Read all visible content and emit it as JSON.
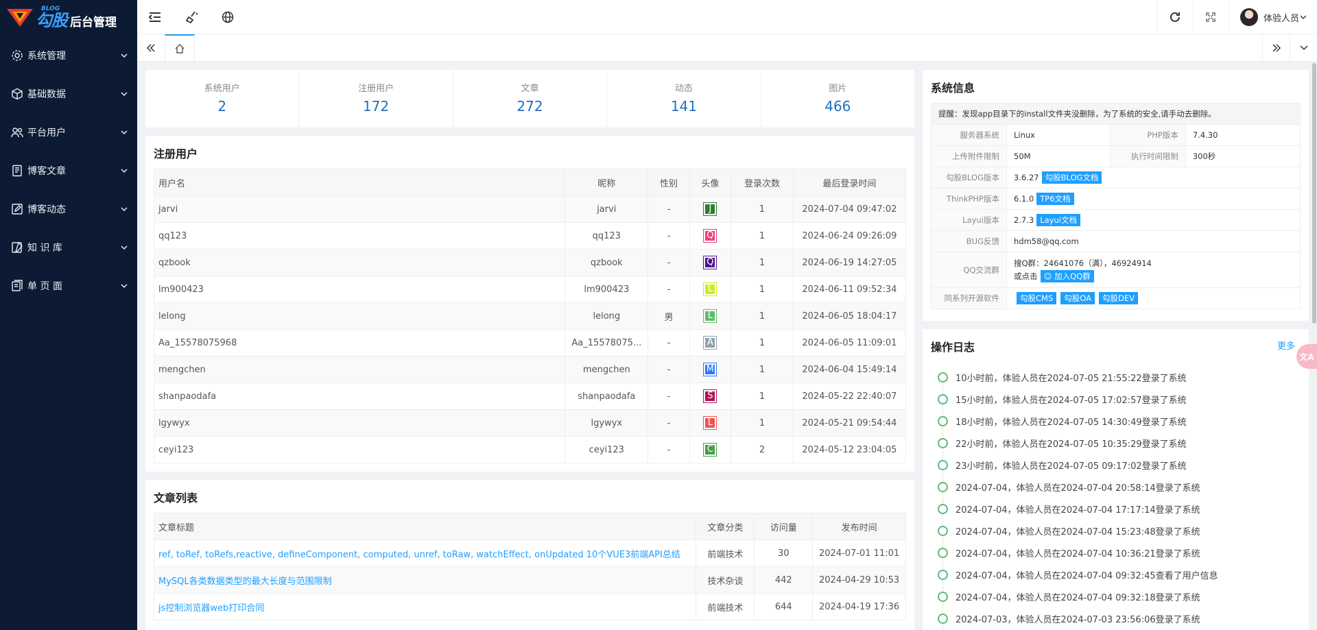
{
  "brand": {
    "blog": "BLOG",
    "name": "勾股",
    "subtitle": "后台管理"
  },
  "menu": [
    {
      "label": "系统管理",
      "icon": "gear-icon"
    },
    {
      "label": "基础数据",
      "icon": "cube-icon"
    },
    {
      "label": "平台用户",
      "icon": "users-icon"
    },
    {
      "label": "博客文章",
      "icon": "article-icon"
    },
    {
      "label": "博客动态",
      "icon": "edit-icon"
    },
    {
      "label": "知 识 库",
      "icon": "notebook-icon"
    },
    {
      "label": "单 页 面",
      "icon": "page-icon"
    }
  ],
  "header": {
    "username": "体验人员"
  },
  "stats": [
    {
      "label": "系统用户",
      "value": "2"
    },
    {
      "label": "注册用户",
      "value": "172"
    },
    {
      "label": "文章",
      "value": "272"
    },
    {
      "label": "动态",
      "value": "141"
    },
    {
      "label": "图片",
      "value": "466"
    }
  ],
  "users": {
    "title": "注册用户",
    "columns": [
      "用户名",
      "昵称",
      "性别",
      "头像",
      "登录次数",
      "最后登录时间"
    ],
    "rows": [
      {
        "username": "jarvi",
        "nickname": "jarvi",
        "gender": "-",
        "avatar": "J",
        "color": "#2e7d32",
        "logins": "1",
        "last": "2024-07-04 09:47:02"
      },
      {
        "username": "qq123",
        "nickname": "qq123",
        "gender": "-",
        "avatar": "Q",
        "color": "#ec407a",
        "logins": "1",
        "last": "2024-06-24 09:26:09"
      },
      {
        "username": "qzbook",
        "nickname": "qzbook",
        "gender": "-",
        "avatar": "Q",
        "color": "#4a148c",
        "logins": "1",
        "last": "2024-06-19 14:27:05"
      },
      {
        "username": "lm900423",
        "nickname": "lm900423",
        "gender": "-",
        "avatar": "L",
        "color": "#c6ef1f",
        "logins": "1",
        "last": "2024-06-11 09:52:34"
      },
      {
        "username": "lelong",
        "nickname": "lelong",
        "gender": "男",
        "avatar": "L",
        "color": "#66bb6a",
        "logins": "1",
        "last": "2024-06-05 18:04:17"
      },
      {
        "username": "Aa_15578075968",
        "nickname": "Aa_15578075...",
        "gender": "-",
        "avatar": "A",
        "color": "#90a4ae",
        "logins": "1",
        "last": "2024-06-05 11:09:01"
      },
      {
        "username": "mengchen",
        "nickname": "mengchen",
        "gender": "-",
        "avatar": "M",
        "color": "#2979ff",
        "logins": "1",
        "last": "2024-06-04 15:49:14"
      },
      {
        "username": "shanpaodafa",
        "nickname": "shanpaodafa",
        "gender": "-",
        "avatar": "S",
        "color": "#ad1457",
        "logins": "1",
        "last": "2024-05-22 22:40:07"
      },
      {
        "username": "lgywyx",
        "nickname": "lgywyx",
        "gender": "-",
        "avatar": "L",
        "color": "#ef5350",
        "logins": "1",
        "last": "2024-05-21 09:54:44"
      },
      {
        "username": "ceyi123",
        "nickname": "ceyi123",
        "gender": "-",
        "avatar": "C",
        "color": "#43a047",
        "logins": "2",
        "last": "2024-05-12 23:04:05"
      }
    ]
  },
  "articles": {
    "title": "文章列表",
    "columns": [
      "文章标题",
      "文章分类",
      "访问量",
      "发布时间"
    ],
    "rows": [
      {
        "title": "ref, toRef, toRefs,reactive, defineComponent, computed, unref, toRaw, watchEffect, onUpdated 10个VUE3前端API总结",
        "cat": "前端技术",
        "views": "30",
        "time": "2024-07-01 11:01"
      },
      {
        "title": "MySQL各类数据类型的最大长度与范围限制",
        "cat": "技术杂谈",
        "views": "442",
        "time": "2024-04-29 10:53"
      },
      {
        "title": "js控制浏览器web打印合同",
        "cat": "前端技术",
        "views": "644",
        "time": "2024-04-19 17:36"
      }
    ]
  },
  "sysinfo": {
    "title": "系统信息",
    "warning": "提醒：发现app目录下的install文件夹没删除，为了系统的安全,请手动去删除。",
    "server_k": "服务器系统",
    "server_v": "Linux",
    "php_k": "PHP版本",
    "php_v": "7.4.30",
    "upload_k": "上传附件限制",
    "upload_v": "50M",
    "exec_k": "执行时间限制",
    "exec_v": "300秒",
    "blog_k": "勾股BLOG版本",
    "blog_v": "3.6.27",
    "blog_btn": "勾股BLOG文档",
    "tp_k": "ThinkPHP版本",
    "tp_v": "6.1.0",
    "tp_btn": "TP6文档",
    "layui_k": "Layui版本",
    "layui_v": "2.7.3",
    "layui_btn": "Layui文档",
    "bug_k": "BUG反馈",
    "bug_v": "hdm58@qq.com",
    "qq_k": "QQ交流群",
    "qq_v": "搜Q群：24641076（满），46924914",
    "qq_or": "或点击",
    "qq_btn": "加入QQ群",
    "os_k": "同系列开源软件",
    "os_btns": [
      "勾股CMS",
      "勾股OA",
      "勾股DEV"
    ]
  },
  "logs": {
    "title": "操作日志",
    "more": "更多",
    "items": [
      "10小时前，体验人员在2024-07-05 21:55:22登录了系统",
      "15小时前，体验人员在2024-07-05 17:02:57登录了系统",
      "18小时前，体验人员在2024-07-05 14:30:49登录了系统",
      "22小时前，体验人员在2024-07-05 10:35:29登录了系统",
      "23小时前，体验人员在2024-07-05 09:17:02登录了系统",
      "2024-07-04，体验人员在2024-07-04 20:58:14登录了系统",
      "2024-07-04，体验人员在2024-07-04 17:17:14登录了系统",
      "2024-07-04，体验人员在2024-07-04 15:23:48登录了系统",
      "2024-07-04，体验人员在2024-07-04 10:36:21登录了系统",
      "2024-07-04，体验人员在2024-07-04 09:32:45查看了用户信息",
      "2024-07-04，体验人员在2024-07-04 09:32:18登录了系统",
      "2024-07-03，体验人员在2024-07-03 23:56:06登录了系统"
    ]
  }
}
